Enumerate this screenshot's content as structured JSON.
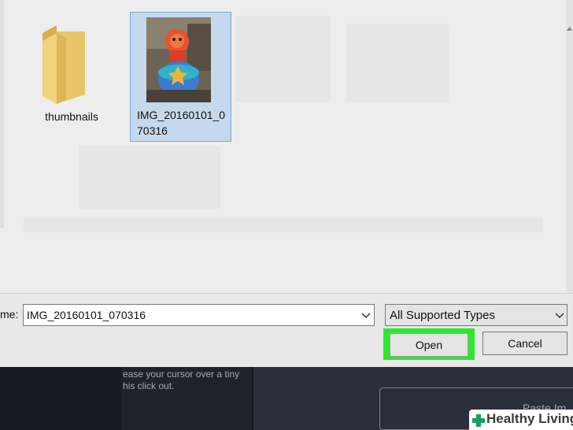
{
  "file_pane": {
    "items": [
      {
        "label": "thumbnails",
        "icon": "folder-icon"
      },
      {
        "label": "IMG_20160101_070316",
        "icon": "image-thumbnail",
        "selected": true
      }
    ]
  },
  "filename": {
    "label": "me:",
    "value": "IMG_20160101_070316"
  },
  "file_type": {
    "selected": "All Supported Types"
  },
  "buttons": {
    "open": "Open",
    "cancel": "Cancel"
  },
  "background_app": {
    "snippet_line1": "ease your cursor over a tiny",
    "snippet_line2": "his click out.",
    "paste_label": "Paste Im"
  },
  "watermark": {
    "text": "Healthy Living"
  },
  "colors": {
    "highlight": "#2ee82e",
    "selection_fill": "#c6d8ec",
    "selection_border": "#7ea9d8",
    "folder": "#e9c56a"
  }
}
